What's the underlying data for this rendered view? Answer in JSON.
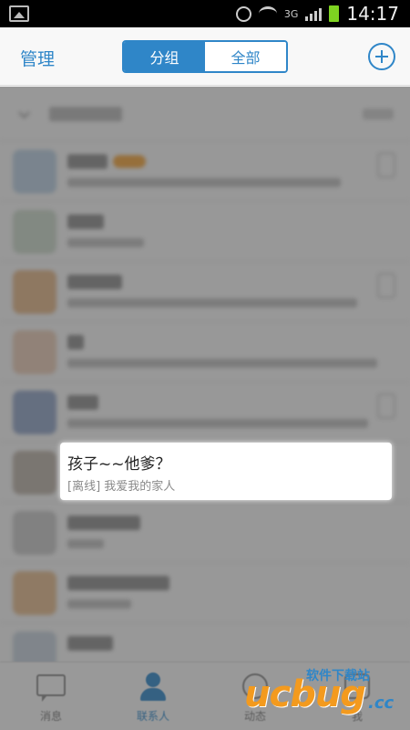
{
  "status_bar": {
    "network": "3G",
    "time": "14:17"
  },
  "header": {
    "manage_label": "管理",
    "segments": [
      "分组",
      "全部"
    ],
    "selected_segment": "分组"
  },
  "highlighted_contact": {
    "name": "孩子~~他爹？",
    "signature": "[离线] 我爱我的家人"
  },
  "tab_bar": {
    "tabs": [
      {
        "label": "消息",
        "icon": "message-icon"
      },
      {
        "label": "联系人",
        "icon": "contacts-icon"
      },
      {
        "label": "动态",
        "icon": "activity-icon"
      },
      {
        "label": "我",
        "icon": "profile-icon"
      }
    ],
    "active_tab": "联系人"
  },
  "watermark": {
    "brand": "ucbug",
    "tagline": "软件下载站",
    "suffix": ".cc"
  },
  "colors": {
    "accent": "#2f86c8",
    "watermark_orange": "#f39a1e"
  }
}
